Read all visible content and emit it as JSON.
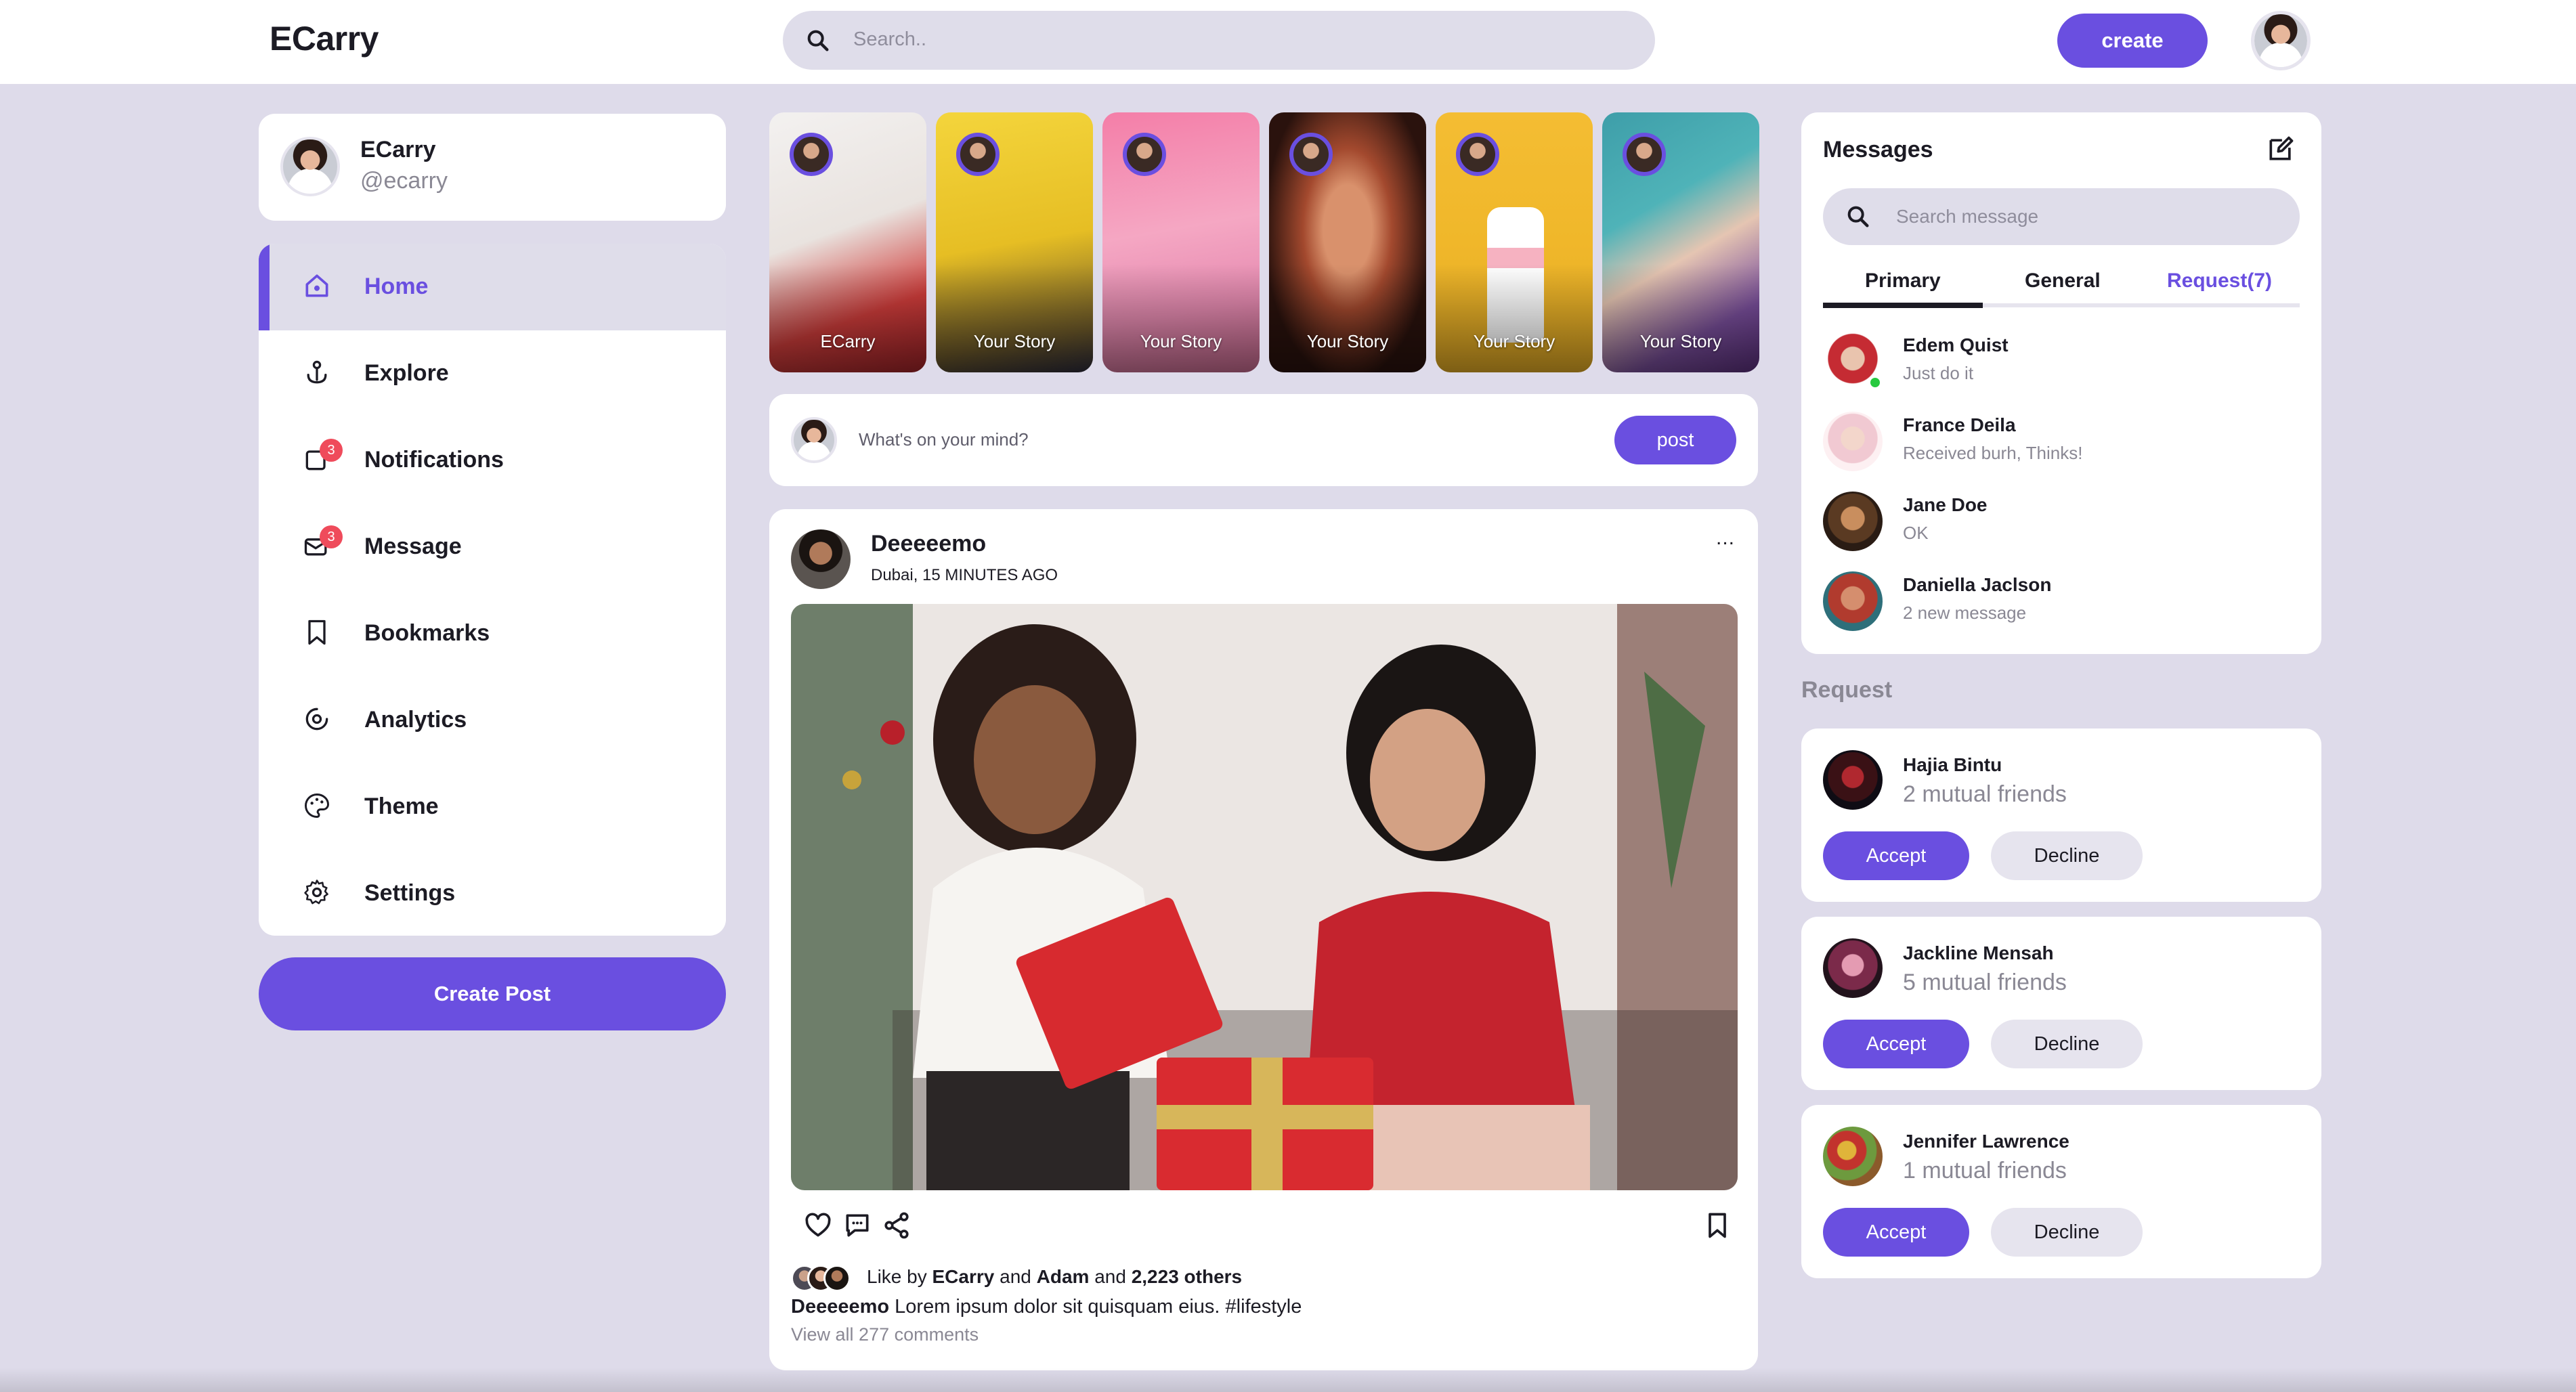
{
  "app": {
    "logo": "ECarry"
  },
  "topbar": {
    "search_placeholder": "Search..",
    "create_label": "create"
  },
  "profile": {
    "name": "ECarry",
    "handle": "@ecarry"
  },
  "sidebar": {
    "items": [
      {
        "label": "Home",
        "icon": "home-icon",
        "active": true
      },
      {
        "label": "Explore",
        "icon": "explore-icon"
      },
      {
        "label": "Notifications",
        "icon": "bell-icon",
        "badge": "3"
      },
      {
        "label": "Message",
        "icon": "envelope-icon",
        "badge": "3"
      },
      {
        "label": "Bookmarks",
        "icon": "bookmark-icon"
      },
      {
        "label": "Analytics",
        "icon": "analytics-icon"
      },
      {
        "label": "Theme",
        "icon": "palette-icon"
      },
      {
        "label": "Settings",
        "icon": "gear-icon"
      }
    ],
    "create_post_label": "Create Post"
  },
  "stories": [
    {
      "label": "ECarry"
    },
    {
      "label": "Your Story"
    },
    {
      "label": "Your Story"
    },
    {
      "label": "Your Story"
    },
    {
      "label": "Your Story"
    },
    {
      "label": "Your Story"
    }
  ],
  "composer": {
    "placeholder": "What's on your mind?",
    "post_label": "post"
  },
  "post": {
    "author": "Deeeeemo",
    "meta": "Dubai, 15 MINUTES AGO",
    "more": "...",
    "likes_prefix": "Like by",
    "liker1": "ECarry",
    "and1": "and",
    "liker2": "Adam",
    "and2": "and",
    "others": "2,223 others",
    "caption_author": "Deeeeemo",
    "caption_text": "Lorem ipsum dolor sit quisquam eius. #lifestyle",
    "comments": "View all 277 comments"
  },
  "messages": {
    "title": "Messages",
    "search_placeholder": "Search message",
    "tabs": [
      "Primary",
      "General",
      "Request(7)"
    ],
    "list": [
      {
        "name": "Edem Quist",
        "text": "Just do it",
        "online": true
      },
      {
        "name": "France Deila",
        "text": "Received burh, Thinks!"
      },
      {
        "name": "Jane Doe",
        "text": "OK"
      },
      {
        "name": "Daniella Jaclson",
        "text": "2 new message"
      }
    ]
  },
  "requests": {
    "title": "Request",
    "accept_label": "Accept",
    "decline_label": "Decline",
    "items": [
      {
        "name": "Hajia Bintu",
        "mutual": "2 mutual friends"
      },
      {
        "name": "Jackline Mensah",
        "mutual": "5 mutual friends"
      },
      {
        "name": "Jennifer Lawrence",
        "mutual": "1 mutual friends"
      }
    ]
  },
  "colors": {
    "accent": "#6a4fe0",
    "background": "#dedbea",
    "badge": "#ef4b5b",
    "online": "#27c93f"
  }
}
